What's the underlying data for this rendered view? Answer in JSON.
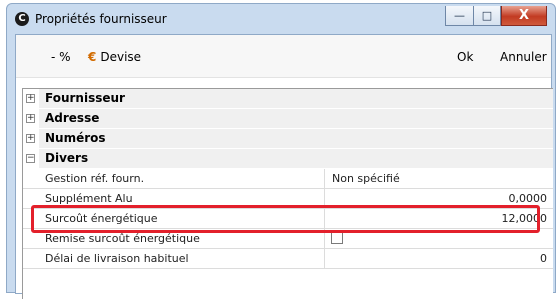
{
  "window": {
    "title": "Propriétés fournisseur",
    "icon": "app-icon",
    "controls": {
      "minimize": "—",
      "maximize": "□",
      "close": "X"
    }
  },
  "toolbar": {
    "percent_label": "- %",
    "currency_symbol": "€",
    "currency_label": "Devise",
    "ok_label": "Ok",
    "cancel_label": "Annuler",
    "currency_color": "#d26b00"
  },
  "grid": {
    "categories": [
      {
        "label": "Fournisseur",
        "expander": "+"
      },
      {
        "label": "Adresse",
        "expander": "+"
      },
      {
        "label": "Numéros",
        "expander": "+"
      },
      {
        "label": "Divers",
        "expander": "−"
      }
    ],
    "properties": [
      {
        "name": "Gestion réf. fourn.",
        "value": "Non spécifié"
      },
      {
        "name": "Supplément Alu",
        "value": "0,0000"
      },
      {
        "name": "Surcoût énergétique",
        "value": "12,0000"
      },
      {
        "name": "Remise surcoût énergétique",
        "value": "",
        "checked": false
      },
      {
        "name": "Délai de livraison habituel",
        "value": "0"
      }
    ]
  },
  "highlight_color": "#e3202b"
}
